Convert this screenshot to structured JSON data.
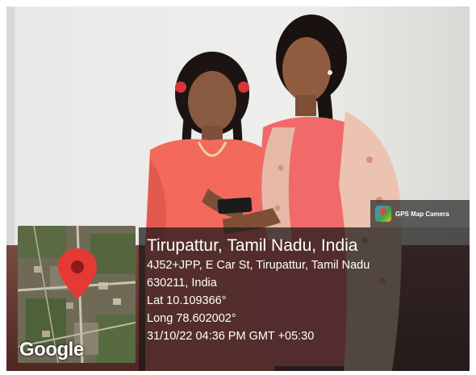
{
  "badge": {
    "label": "GPS Map Camera",
    "icon": "gps-map-camera-icon"
  },
  "map": {
    "logo_text": "Google",
    "pin_color": "#e53935"
  },
  "location": {
    "title": "Tirupattur, Tamil Nadu, India",
    "address_line1": "4J52+JPP, E Car St, Tirupattur, Tamil Nadu",
    "address_line2": "630211, India",
    "lat": "Lat 10.109366°",
    "long": "Long 78.602002°",
    "datetime": "31/10/22 04:36 PM GMT +05:30"
  },
  "colors": {
    "panel_bg": "#161616",
    "wall": "#e9e9e7",
    "floor": "#6b3b33",
    "left_dress": "#f36a5d",
    "right_dress": "#f06a6a",
    "dupatta": "#ecc2b0"
  }
}
